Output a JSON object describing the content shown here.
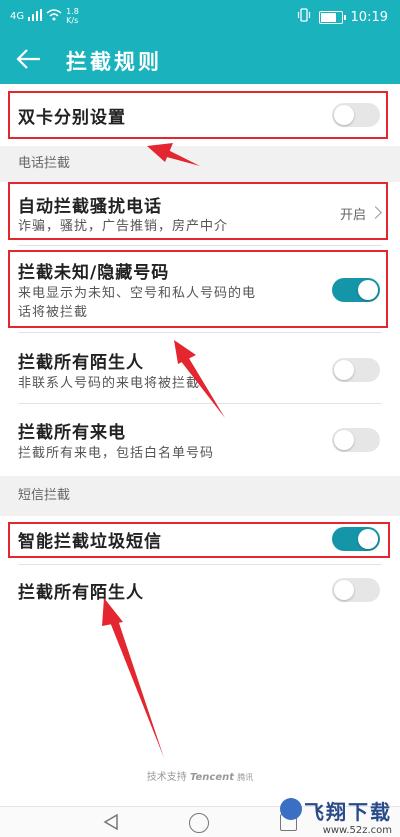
{
  "status_bar": {
    "network": "4G",
    "speed": "1.8\nK/s",
    "time": "10:19",
    "icons": [
      "signal-icon",
      "wifi-icon",
      "vibrate-icon",
      "battery-icon"
    ]
  },
  "header": {
    "back_icon": "arrow-left-icon",
    "title": "拦截规则"
  },
  "rows": {
    "dual_sim": {
      "label": "双卡分别设置",
      "enabled": false
    }
  },
  "sections": {
    "phone": {
      "title": "电话拦截"
    },
    "sms": {
      "title": "短信拦截"
    }
  },
  "phone_items": {
    "auto_block": {
      "label": "自动拦截骚扰电话",
      "desc": "诈骗，骚扰，广告推销，房产中介",
      "value": "开启"
    },
    "unknown": {
      "label": "拦截未知/隐藏号码",
      "desc1": "来电显示为未知、空号和私人号码的电",
      "desc2": "话将被拦截",
      "enabled": true
    },
    "strangers": {
      "label": "拦截所有陌生人",
      "desc": "非联系人号码的来电将被拦截",
      "enabled": false
    },
    "all_calls": {
      "label": "拦截所有来电",
      "desc": "拦截所有来电，包括白名单号码",
      "enabled": false
    }
  },
  "sms_items": {
    "smart_spam": {
      "label": "智能拦截垃圾短信",
      "enabled": true
    },
    "strangers": {
      "label": "拦截所有陌生人",
      "enabled": false
    }
  },
  "footer": {
    "support": "技术支持",
    "brand": "Tencent",
    "brand_cn": "腾讯"
  },
  "watermark": {
    "title": "飞翔下载",
    "url": "www.52z.com"
  },
  "colors": {
    "accent": "#1ab3bd",
    "toggle_on": "#1596a8",
    "highlight": "#e3262f"
  }
}
